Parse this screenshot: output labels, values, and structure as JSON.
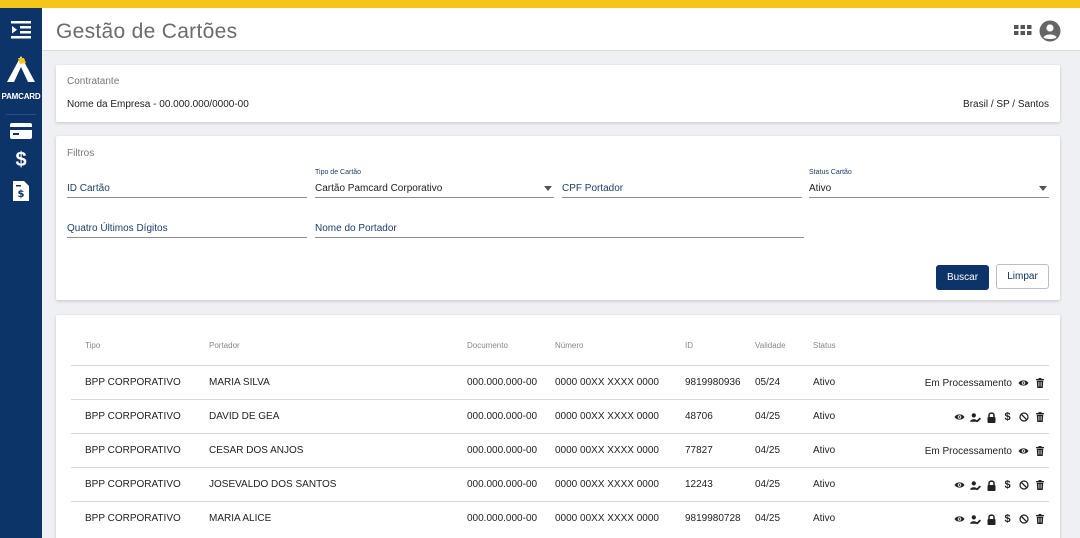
{
  "header": {
    "title": "Gestão de Cartões"
  },
  "sidebar": {
    "logo_text": "PAMCARD"
  },
  "contratante": {
    "label": "Contratante",
    "name": "Nome da Empresa  -  00.000.000/0000-00",
    "location": "Brasil / SP / Santos"
  },
  "filters": {
    "label": "Filtros",
    "id_cartao": "ID Cartão",
    "tipo_label": "Tipo de Cartão",
    "tipo_value": "Cartão Pamcard Corporativo",
    "cpf_portador": "CPF Portador",
    "status_label": "Status Cartão",
    "status_value": "Ativo",
    "quatro_digitos": "Quatro Últimos Dígitos",
    "nome_portador": "Nome do Portador",
    "buscar": "Buscar",
    "limpar": "Limpar"
  },
  "table": {
    "headers": [
      "Tipo",
      "Portador",
      "Documento",
      "Número",
      "ID",
      "Validade",
      "Status"
    ],
    "rows": [
      {
        "tipo": "BPP CORPORATIVO",
        "portador": "MARIA SILVA",
        "documento": "000.000.000-00",
        "numero": "0000 00XX XXXX 0000",
        "id": "9819980936",
        "validade": "05/24",
        "status": "Ativo",
        "processing": "Em Processamento"
      },
      {
        "tipo": "BPP CORPORATIVO",
        "portador": "DAVID DE GEA",
        "documento": "000.000.000-00",
        "numero": "0000 00XX XXXX 0000",
        "id": "48706",
        "validade": "04/25",
        "status": "Ativo",
        "processing": ""
      },
      {
        "tipo": "BPP CORPORATIVO",
        "portador": "CESAR DOS ANJOS",
        "documento": "000.000.000-00",
        "numero": "0000 00XX XXXX 0000",
        "id": "77827",
        "validade": "04/25",
        "status": "Ativo",
        "processing": "Em Processamento"
      },
      {
        "tipo": "BPP CORPORATIVO",
        "portador": "JOSEVALDO DOS SANTOS",
        "documento": "000.000.000-00",
        "numero": "0000 00XX XXXX 0000",
        "id": "12243",
        "validade": "04/25",
        "status": "Ativo",
        "processing": ""
      },
      {
        "tipo": "BPP CORPORATIVO",
        "portador": "MARIA ALICE",
        "documento": "000.000.000-00",
        "numero": "0000 00XX XXXX 0000",
        "id": "9819980728",
        "validade": "04/25",
        "status": "Ativo",
        "processing": ""
      }
    ]
  },
  "colors": {
    "accent": "#f5c518",
    "primary": "#0d3468"
  }
}
